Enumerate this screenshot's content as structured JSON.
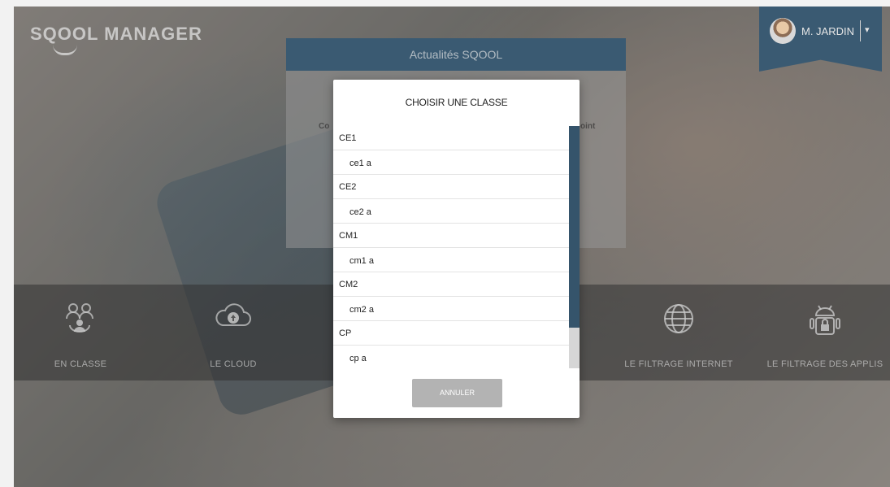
{
  "app": {
    "logo_text": "SQOOL MANAGER",
    "user_name": "M. JARDIN",
    "user_menu_caret": "▾"
  },
  "news": {
    "title": "Actualités SQOOL",
    "body_fragment_left": "Co",
    "body_fragment_right": "oint"
  },
  "nav": {
    "items": [
      {
        "label": "EN CLASSE",
        "icon": "classroom-icon"
      },
      {
        "label": "LE CLOUD",
        "icon": "cloud-upload-icon"
      },
      {
        "label": "LE FILTRAGE INTERNET",
        "icon": "globe-icon"
      },
      {
        "label": "LE FILTRAGE DES APPLIS",
        "icon": "android-lock-icon"
      }
    ]
  },
  "dialog": {
    "title": "CHOISIR UNE CLASSE",
    "rows": [
      {
        "type": "group",
        "label": "CE1"
      },
      {
        "type": "item",
        "label": "ce1 a"
      },
      {
        "type": "group",
        "label": "CE2"
      },
      {
        "type": "item",
        "label": "ce2 a"
      },
      {
        "type": "group",
        "label": "CM1"
      },
      {
        "type": "item",
        "label": "cm1 a"
      },
      {
        "type": "group",
        "label": "CM2"
      },
      {
        "type": "item",
        "label": "cm2 a"
      },
      {
        "type": "group",
        "label": "CP"
      },
      {
        "type": "item",
        "label": "cp a"
      }
    ],
    "cancel_label": "ANNULER"
  },
  "colors": {
    "accent_dark_blue": "#3a5a72",
    "scrollbar_thumb": "#35546b",
    "cancel_button": "#b3b3b3"
  }
}
